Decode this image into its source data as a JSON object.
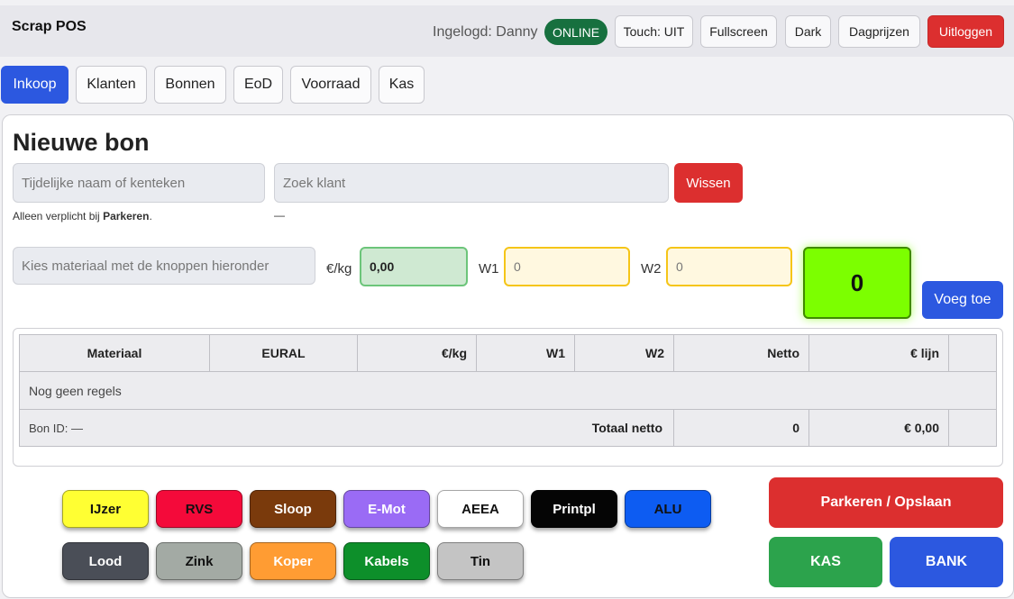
{
  "header": {
    "brand": "Scrap POS",
    "user": "Ingelogd: Danny",
    "status": "ONLINE",
    "buttons": [
      "Touch: UIT",
      "Fullscreen",
      "Dark",
      "Dagprijzen",
      "Uitloggen"
    ]
  },
  "tabs": [
    "Inkoop",
    "Klanten",
    "Bonnen",
    "EoD",
    "Voorraad",
    "Kas"
  ],
  "form": {
    "title": "Nieuwe bon",
    "name_placeholder": "Tijdelijke naam of kenteken",
    "name_hint_prefix": "Alleen verplicht bij ",
    "name_hint_bold": "Parkeren",
    "name_hint_suffix": ".",
    "customer_placeholder": "Zoek klant",
    "customer_value": "—",
    "clear_label": "Wissen",
    "material_placeholder": "Kies materiaal met de knoppen hieronder",
    "price_label": "€/kg",
    "price_value": "0,00",
    "w1_label": "W1",
    "w1_value": "0",
    "w2_label": "W2",
    "w2_value": "0",
    "netto_value": "0",
    "add_label": "Voeg toe"
  },
  "table": {
    "headers": [
      "Materiaal",
      "EURAL",
      "€/kg",
      "W1",
      "W2",
      "Netto",
      "€ lijn",
      ""
    ],
    "empty_text": "Nog geen regels",
    "bon_id": "Bon ID: —",
    "total_label": "Totaal netto",
    "total_netto": "0",
    "total_amount": "€ 0,00"
  },
  "materials": [
    {
      "label": "IJzer",
      "bg": "#ffff33",
      "fg": "#111111"
    },
    {
      "label": "RVS",
      "bg": "#f40a3a",
      "fg": "#111111"
    },
    {
      "label": "Sloop",
      "bg": "#7a3a0c",
      "fg": "#ffffff"
    },
    {
      "label": "E-Mot",
      "bg": "#9a6bf5",
      "fg": "#ffffff"
    },
    {
      "label": "AEEA",
      "bg": "#ffffff",
      "fg": "#111111"
    },
    {
      "label": "Printpl",
      "bg": "#050505",
      "fg": "#ffffff"
    },
    {
      "label": "ALU",
      "bg": "#0d5cf2",
      "fg": "#111111"
    },
    {
      "label": "Lood",
      "bg": "#4a4e57",
      "fg": "#ffffff"
    },
    {
      "label": "Zink",
      "bg": "#a3aaa4",
      "fg": "#111111"
    },
    {
      "label": "Koper",
      "bg": "#ff9c33",
      "fg": "#ffffff"
    },
    {
      "label": "Kabels",
      "bg": "#0d8f2a",
      "fg": "#ffffff"
    },
    {
      "label": "Tin",
      "bg": "#c4c4c4",
      "fg": "#111111"
    }
  ],
  "actions": {
    "park": "Parkeren / Opslaan",
    "cash": "KAS",
    "bank": "BANK"
  },
  "colors": {
    "primary": "#2c58e0",
    "danger": "#dc2f2f",
    "success": "#2ca34c",
    "online": "#17703f"
  }
}
